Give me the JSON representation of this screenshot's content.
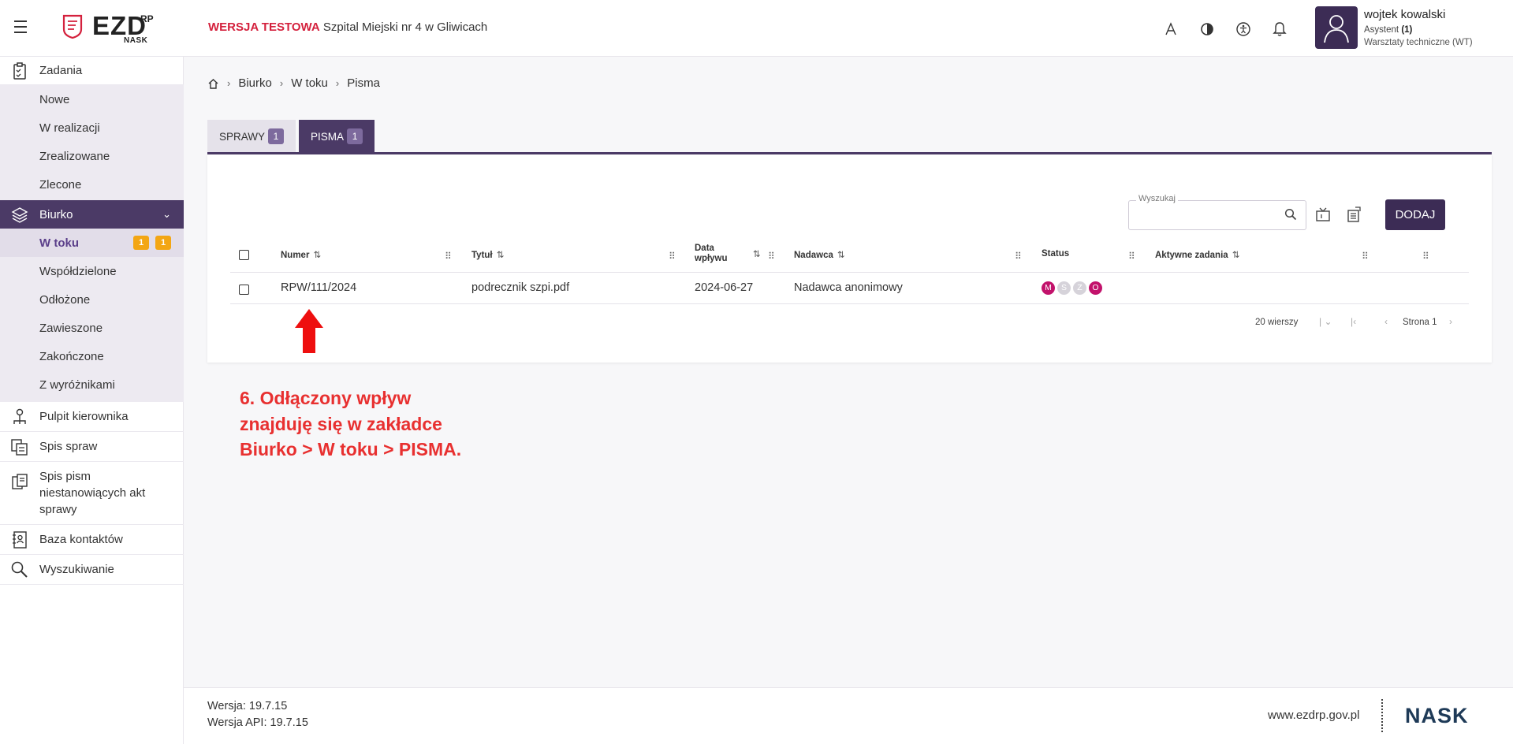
{
  "header": {
    "logo_text": "EZD",
    "logo_sup": "RP",
    "logo_sub": "NASK",
    "env_label": "WERSJA TESTOWA",
    "org_name": "Szpital Miejski nr 4 w Gliwicach",
    "icons": [
      "font-size-icon",
      "contrast-icon",
      "accessibility-icon",
      "bell-icon"
    ],
    "user": {
      "name": "wojtek kowalski",
      "role_prefix": "Asystent",
      "role_count": "(1)",
      "unit": "Warsztaty techniczne (WT)"
    }
  },
  "sidebar": {
    "zadania": {
      "label": "Zadania",
      "items": [
        "Nowe",
        "W realizacji",
        "Zrealizowane",
        "Zlecone"
      ]
    },
    "biurko": {
      "label": "Biurko",
      "items": [
        {
          "label": "W toku",
          "badges": [
            "1",
            "1"
          ]
        },
        {
          "label": "Współdzielone"
        },
        {
          "label": "Odłożone"
        },
        {
          "label": "Zawieszone"
        },
        {
          "label": "Zakończone"
        },
        {
          "label": "Z wyróżnikami"
        }
      ]
    },
    "other": [
      "Pulpit kierownika",
      "Spis spraw",
      "Spis pism niestanowiących akt sprawy",
      "Baza kontaktów",
      "Wyszukiwanie"
    ]
  },
  "breadcrumb": [
    "Biurko",
    "W toku",
    "Pisma"
  ],
  "tabs": [
    {
      "label": "SPRAWY",
      "count": "1"
    },
    {
      "label": "PISMA",
      "count": "1"
    }
  ],
  "toolbar": {
    "search_label": "Wyszukaj",
    "search_value": "",
    "add_label": "DODAJ"
  },
  "table": {
    "columns": [
      "Numer",
      "Tytuł",
      "Data wpływu",
      "Nadawca",
      "Status",
      "Aktywne zadania"
    ],
    "rows": [
      {
        "numer": "RPW/111/2024",
        "tytul": "podrecznik szpi.pdf",
        "data": "2024-06-27",
        "nadawca": "Nadawca anonimowy",
        "status": [
          {
            "letter": "M",
            "active": true
          },
          {
            "letter": "S",
            "active": false
          },
          {
            "letter": "Z",
            "active": false
          },
          {
            "letter": "O",
            "active": true
          }
        ],
        "aktywne_zadania": ""
      }
    ],
    "rows_per_page": "20 wierszy",
    "page_label": "Strona 1"
  },
  "annotation": {
    "line1": "6. Odłączony wpływ",
    "line2": "znajduję się w zakładce",
    "line3": "Biurko > W toku > PISMA."
  },
  "footer": {
    "version": "Wersja: 19.7.15",
    "api_version": "Wersja API: 19.7.15",
    "site": "www.ezdrp.gov.pl",
    "brand": "NASK"
  },
  "colors": {
    "primary": "#4b3a66",
    "accent_red": "#d4213d",
    "badge": "#f3a614",
    "status_on": "#c2126b"
  }
}
